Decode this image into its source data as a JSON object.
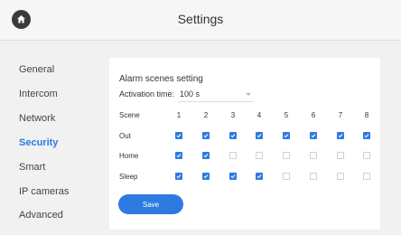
{
  "header": {
    "title": "Settings",
    "home_icon": "home-icon"
  },
  "sidebar": {
    "items": [
      {
        "label": "General",
        "active": false
      },
      {
        "label": "Intercom",
        "active": false
      },
      {
        "label": "Network",
        "active": false
      },
      {
        "label": "Security",
        "active": true
      },
      {
        "label": "Smart",
        "active": false
      },
      {
        "label": "IP cameras",
        "active": false
      },
      {
        "label": "Advanced",
        "active": false
      }
    ]
  },
  "panel": {
    "title": "Alarm scenes setting",
    "activation_label": "Activation time:",
    "activation_value": "100 s",
    "scene_header": "Scene",
    "scene_numbers": [
      "1",
      "2",
      "3",
      "4",
      "5",
      "6",
      "7",
      "8"
    ],
    "rows": [
      {
        "label": "Out",
        "checked": [
          true,
          true,
          true,
          true,
          true,
          true,
          true,
          true
        ]
      },
      {
        "label": "Home",
        "checked": [
          true,
          true,
          false,
          false,
          false,
          false,
          false,
          false
        ]
      },
      {
        "label": "Sleep",
        "checked": [
          true,
          true,
          true,
          true,
          false,
          false,
          false,
          false
        ]
      }
    ],
    "save_label": "Save"
  },
  "colors": {
    "accent": "#2d7be0",
    "background": "#f1f1f1",
    "panel": "#ffffff",
    "home_button": "#3a3a3a"
  }
}
